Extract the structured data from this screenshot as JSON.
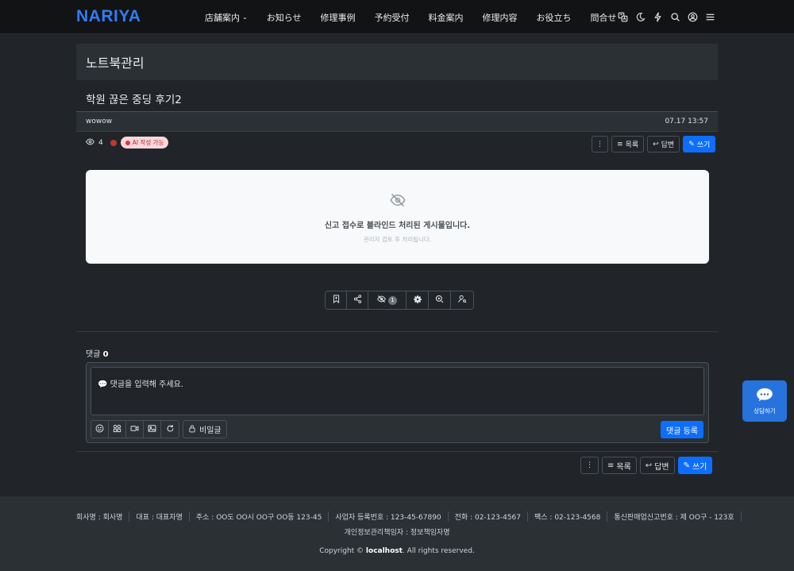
{
  "header": {
    "logo": "NARIYA",
    "nav": [
      {
        "label": "店舗案内",
        "dropdown": true
      },
      {
        "label": "お知らせ"
      },
      {
        "label": "修理事例"
      },
      {
        "label": "予約受付"
      },
      {
        "label": "料金案内"
      },
      {
        "label": "修理内容"
      },
      {
        "label": "お役立ち"
      },
      {
        "label": "問合せ"
      }
    ],
    "icons": [
      "translate-icon",
      "moon-icon",
      "lightning-icon",
      "search-icon",
      "user-icon",
      "menu-icon"
    ]
  },
  "board": {
    "title": "노트북관리"
  },
  "post": {
    "title": "학원 끊은 중딩 후기2",
    "author": "wowow",
    "datetime": "07.17 13:57",
    "views": "4",
    "ai_badge": "AI 작성 가능"
  },
  "buttons": {
    "list": "목록",
    "reply": "답변",
    "write": "쓰기"
  },
  "blind": {
    "main": "신고 접수로 블라인드 처리된 게시물입니다.",
    "sub": "관리자 검토 후 처리됩니다."
  },
  "actions": {
    "hide_count": "1"
  },
  "comments": {
    "label": "댓글",
    "count": "0",
    "placeholder": "💬 댓글을 입력해 주세요.",
    "secret_label": "비밀글",
    "submit_label": "댓글 등록"
  },
  "chat": {
    "label": "상담하기"
  },
  "footer": {
    "items": [
      "회사명 : 회사명",
      "대표 : 대표자명",
      "주소 : OO도 OO시 OO구 OO동 123-45",
      "사업자 등록번호 : 123-45-67890",
      "전화 : 02-123-4567",
      "팩스 : 02-123-4568",
      "통신판매업신고번호 : 제 OO구 - 123호"
    ],
    "privacy": "개인정보관리책임자 : 정보책임자명",
    "copyright_prefix": "Copyright ©",
    "copyright_host": "localhost",
    "copyright_suffix": ". All rights reserved."
  },
  "colors": {
    "accent": "#0d6efd",
    "logo": "#2f7cf6",
    "background": "#212529"
  }
}
